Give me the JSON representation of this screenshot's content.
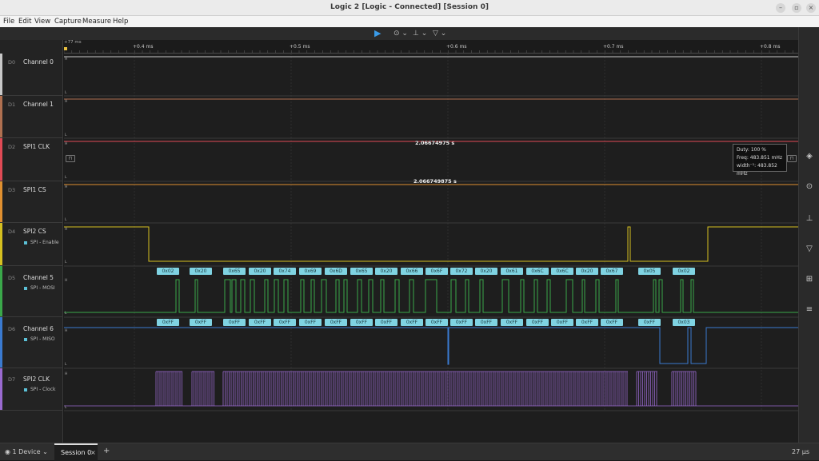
{
  "window": {
    "title": "Logic 2 [Logic - Connected] [Session 0]"
  },
  "menu": [
    "File",
    "Edit",
    "View",
    "Capture",
    "Measure",
    "Help"
  ],
  "timeline": {
    "reference": "+77 ms",
    "ticks": [
      "+0.4 ms",
      "+0.5 ms",
      "+0.6 ms",
      "+0.7 ms",
      "+0.8 ms"
    ]
  },
  "channels": [
    {
      "num": "D0",
      "name": "Channel 0",
      "color": "#c8c8c8",
      "analyzer": ""
    },
    {
      "num": "D1",
      "name": "Channel 1",
      "color": "#b07050",
      "analyzer": ""
    },
    {
      "num": "D2",
      "name": "SPI1 CLK",
      "color": "#e04a55",
      "analyzer": ""
    },
    {
      "num": "D3",
      "name": "SPI1 CS",
      "color": "#e09030",
      "analyzer": ""
    },
    {
      "num": "D4",
      "name": "SPI2 CS",
      "color": "#d6c020",
      "analyzer": "SPI - Enable"
    },
    {
      "num": "D5",
      "name": "Channel 5",
      "color": "#3aa84a",
      "analyzer": "SPI - MOSI"
    },
    {
      "num": "D6",
      "name": "Channel 6",
      "color": "#3a7ad0",
      "analyzer": "SPI - MISO"
    },
    {
      "num": "D7",
      "name": "SPI2 CLK",
      "color": "#9a6ad0",
      "analyzer": "SPI - Clock"
    }
  ],
  "measurements": {
    "spi1_clk_width": "2.06674975 s",
    "spi1_cs_width": "2.066749875 s"
  },
  "mosi_frames": [
    "0x02",
    "0x20",
    "0x65",
    "0x20",
    "0x74",
    "0x69",
    "0x6D",
    "0x65",
    "0x20",
    "0x66",
    "0x6F",
    "0x72",
    "0x20",
    "0x61",
    "0x6C",
    "0x6C",
    "0x20",
    "0x67",
    "0x05",
    "0x02"
  ],
  "miso_frames": [
    "0xFF",
    "0xFF",
    "0xFF",
    "0xFF",
    "0xFF",
    "0xFF",
    "0xFF",
    "0xFF",
    "0xFF",
    "0xFF",
    "0xFF",
    "0xFF",
    "0xFF",
    "0xFF",
    "0xFF",
    "0xFF",
    "0xFF",
    "0xFF",
    "0xFF",
    "0x03"
  ],
  "tooltip": {
    "duty": "Duty: 100 %",
    "freq": "Freq: 483.851 mHz",
    "width": "width⁻¹: 483.852 mHz"
  },
  "status": {
    "devices": "1 Device",
    "session_tab": "Session 0",
    "add_tab": "+",
    "close_tab": "×",
    "timescale": "27 µs"
  },
  "icons": {
    "play": "play-icon",
    "trigger": "trigger-icon",
    "measure": "measure-icon",
    "marker": "marker-icon"
  }
}
